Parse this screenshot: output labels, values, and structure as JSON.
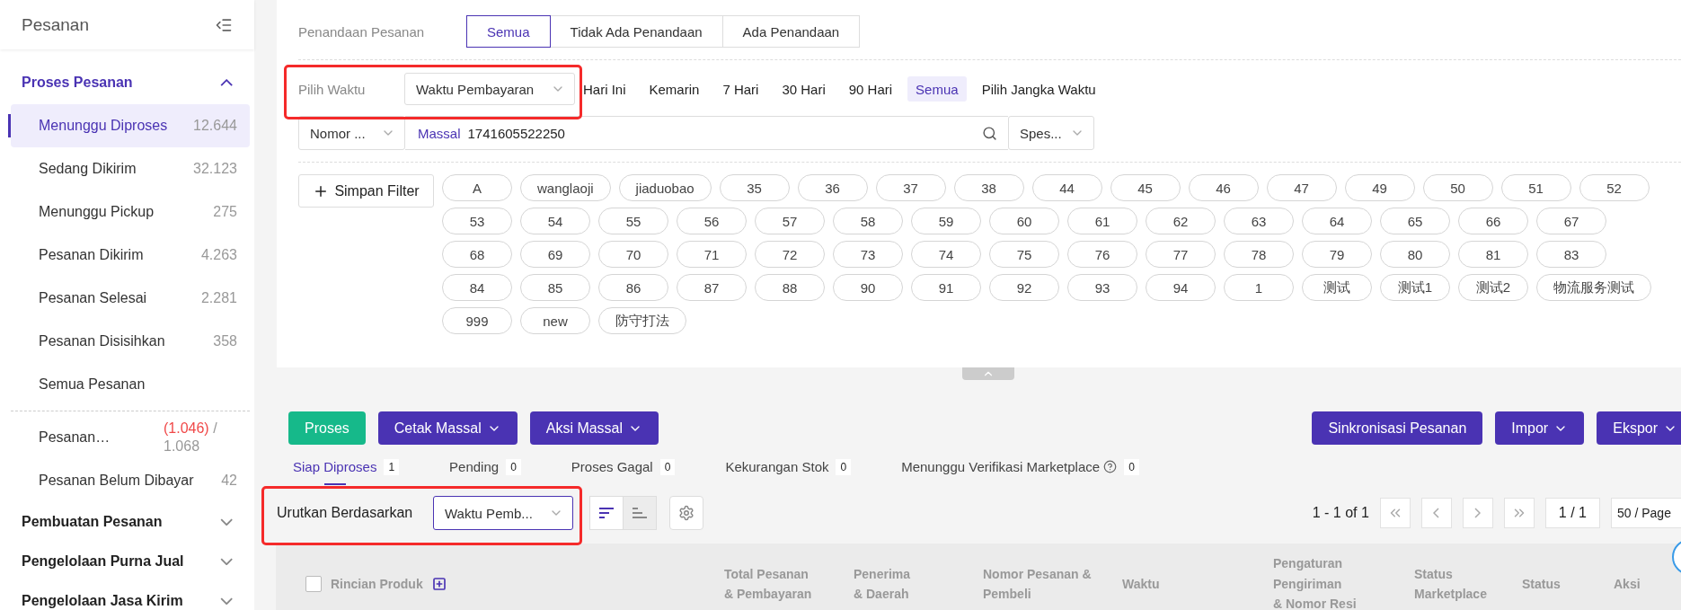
{
  "sidebar": {
    "title": "Pesanan",
    "groups": [
      {
        "label": "Proses Pesanan",
        "expanded": true,
        "items": [
          {
            "label": "Menunggu Diproses",
            "count": "12.644",
            "selected": true
          },
          {
            "label": "Sedang Dikirim",
            "count": "32.123",
            "selected": false
          },
          {
            "label": "Menunggu Pickup",
            "count": "275",
            "selected": false
          },
          {
            "label": "Pesanan Dikirim",
            "count": "4.263",
            "selected": false
          },
          {
            "label": "Pesanan Selesai",
            "count": "2.281",
            "selected": false
          },
          {
            "label": "Pesanan Disisihkan",
            "count": "358",
            "selected": false
          },
          {
            "label": "Semua Pesanan",
            "selected": false
          }
        ],
        "more_items": [
          {
            "label": "Pesanan…",
            "alert_count": "(1.046)",
            "count": "/ 1.068",
            "selected": false
          },
          {
            "label": "Pesanan Belum Dibayar",
            "count": "42",
            "selected": false
          }
        ]
      },
      {
        "label": "Pembuatan Pesanan",
        "expanded": false
      },
      {
        "label": "Pengelolaan Purna Jual",
        "expanded": false
      },
      {
        "label": "Pengelolaan Jasa Kirim",
        "expanded": false
      }
    ]
  },
  "marking": {
    "label": "Penandaan Pesanan",
    "options": [
      {
        "label": "Semua",
        "selected": true
      },
      {
        "label": "Tidak Ada Penandaan",
        "selected": false
      },
      {
        "label": "Ada Penandaan",
        "selected": false
      }
    ]
  },
  "time": {
    "label": "Pilih Waktu",
    "value": "Waktu Pembayaran",
    "highlighted": true,
    "ranges": [
      {
        "label": "Hari Ini",
        "selected": false
      },
      {
        "label": "Kemarin",
        "selected": false
      },
      {
        "label": "7 Hari",
        "selected": false
      },
      {
        "label": "30 Hari",
        "selected": false
      },
      {
        "label": "90 Hari",
        "selected": false
      },
      {
        "label": "Semua",
        "selected": true
      },
      {
        "label": "Pilih Jangka Waktu",
        "selected": false
      }
    ]
  },
  "search": {
    "field_type": "Nomor ...",
    "mode": "Massal",
    "value": "1741605522250",
    "spec": "Spes..."
  },
  "save_filter": "Simpan Filter",
  "tags": [
    "A",
    "wanglaoji",
    "jiaduobao",
    "35",
    "36",
    "37",
    "38",
    "44",
    "45",
    "46",
    "47",
    "49",
    "50",
    "51",
    "52",
    "53",
    "54",
    "55",
    "56",
    "57",
    "58",
    "59",
    "60",
    "61",
    "62",
    "63",
    "64",
    "65",
    "66",
    "67",
    "68",
    "69",
    "70",
    "71",
    "72",
    "73",
    "74",
    "75",
    "76",
    "77",
    "78",
    "79",
    "80",
    "81",
    "83",
    "84",
    "85",
    "86",
    "87",
    "88",
    "90",
    "91",
    "92",
    "93",
    "94",
    "1",
    "测试",
    "测试1",
    "测试2",
    "物流服务测试",
    "999",
    "new",
    "防守打法"
  ],
  "actions": [
    {
      "label": "Proses",
      "kind": "success",
      "dropdown": false
    },
    {
      "label": "Cetak Massal",
      "kind": "primary",
      "dropdown": true
    },
    {
      "label": "Aksi Massal",
      "kind": "primary",
      "dropdown": true
    }
  ],
  "right_actions": [
    {
      "label": "Sinkronisasi Pesanan",
      "kind": "primary",
      "dropdown": false
    },
    {
      "label": "Impor",
      "kind": "primary",
      "dropdown": true
    },
    {
      "label": "Ekspor",
      "kind": "primary",
      "dropdown": true
    }
  ],
  "status_tabs": [
    {
      "label": "Siap Diproses",
      "count": "1",
      "selected": true,
      "help": false
    },
    {
      "label": "Pending",
      "count": "0",
      "selected": false,
      "help": false
    },
    {
      "label": "Proses Gagal",
      "count": "0",
      "selected": false,
      "help": false
    },
    {
      "label": "Kekurangan Stok",
      "count": "0",
      "selected": false,
      "help": false
    },
    {
      "label": "Menunggu Verifikasi Marketplace",
      "count": "0",
      "selected": false,
      "help": true
    }
  ],
  "sort": {
    "label": "Urutkan Berdasarkan",
    "value": "Waktu Pemb...",
    "highlighted": true,
    "directions": [
      {
        "kind": "descending",
        "selected": true
      },
      {
        "kind": "ascending",
        "selected": false
      }
    ]
  },
  "pagination": {
    "summary": "1 - 1 of 1",
    "page": "1 / 1",
    "page_size": "50 / Page"
  },
  "table": {
    "checked": false,
    "product_column": "Rincian Produk",
    "columns": [
      "Total Pesanan\n& Pembayaran",
      "Penerima\n& Daerah",
      "Nomor Pesanan &\nPembeli",
      "Waktu",
      "Pengaturan\nPengiriman\n& Nomor Resi",
      "Status\nMarketplace",
      "Status",
      "Aksi"
    ]
  }
}
